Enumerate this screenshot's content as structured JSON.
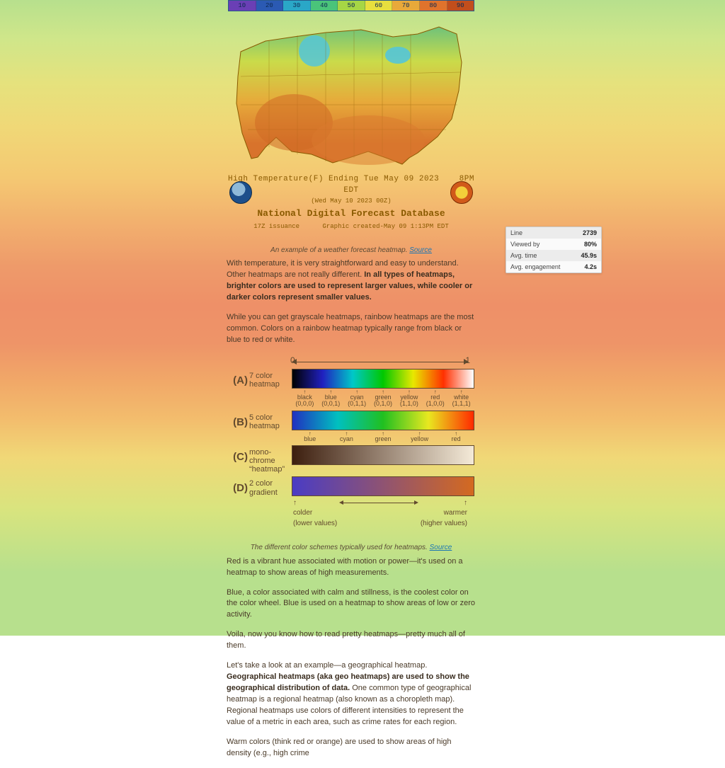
{
  "weather": {
    "scale_ticks": [
      "10",
      "20",
      "30",
      "40",
      "50",
      "60",
      "70",
      "80",
      "90"
    ],
    "line1_left": "High Temperature(F) Ending Tue May 09 2023",
    "line1_right": "8PM EDT",
    "line2": "(Wed May 10 2023 00Z)",
    "title": "National Digital Forecast Database",
    "line3_left": "17Z issuance",
    "line3_right": "Graphic created-May 09  1:13PM EDT"
  },
  "scale_colors": [
    "#6a3fb5",
    "#2b5ab3",
    "#2aa7c7",
    "#4ac47a",
    "#a6d645",
    "#e7df3e",
    "#e8a93a",
    "#e0732c",
    "#c24e1c"
  ],
  "caption1_text": "An example of a weather forecast heatmap. ",
  "caption1_link": "Source",
  "p1_a": "With temperature, it is very straightforward and easy to understand. Other heatmaps are not really different. ",
  "p1_bold": "In all types of heatmaps, brighter colors are used to represent larger values, while cooler or darker colors represent smaller values.",
  "p2": "While you can get grayscale heatmaps, rainbow heatmaps are the most common. Colors on a rainbow heatmap typically range from black or blue to red or white.",
  "schemes": {
    "zero": "0",
    "one": "1",
    "rows": [
      {
        "letter": "(A)",
        "t1": "7 color",
        "t2": "heatmap",
        "ticks": [
          "black\n(0,0,0)",
          "blue\n(0,0,1)",
          "cyan\n(0,1,1)",
          "green\n(0,1,0)",
          "yellow\n(1,1,0)",
          "red\n(1,0,0)",
          "white\n(1,1,1)"
        ]
      },
      {
        "letter": "(B)",
        "t1": "5 color",
        "t2": "heatmap",
        "ticks": [
          "blue",
          "cyan",
          "green",
          "yellow",
          "red"
        ]
      },
      {
        "letter": "(C)",
        "t1": "mono-",
        "t2": "chrome",
        "t3": "“heatmap”",
        "ticks": []
      },
      {
        "letter": "(D)",
        "t1": "2 color",
        "t2": "gradient",
        "ticks": []
      }
    ],
    "foot_left_1": "colder",
    "foot_left_2": "(lower values)",
    "foot_right_1": "warmer",
    "foot_right_2": "(higher values)"
  },
  "caption2_text": "The different color schemes typically used for heatmaps. ",
  "caption2_link": "Source",
  "p3": "Red is a vibrant hue associated with motion or power—it's used on a heatmap to show areas of high measurements.",
  "p4": "Blue, a color associated with calm and stillness, is the coolest color on the color wheel. Blue is used on a heatmap to show areas of low or zero activity.",
  "p5": "Voila, now you know how to read pretty heatmaps—pretty much all of them.",
  "p6_a": "Let's take a look at an example—a geographical heatmap. ",
  "p6_bold": "Geographical heatmaps (aka geo heatmaps) are used to show the geographical distribution of data.",
  "p6_b": " One common type of geographical heatmap is a regional heatmap (also known as a choropleth map). Regional heatmaps use colors of different intensities to represent the value of a metric in each area, such as crime rates for each region.",
  "p7": "Warm colors (think red or orange) are used to show areas of high density (e.g., high crime",
  "tooltip": {
    "rows": [
      {
        "k": "Line",
        "v": "2739"
      },
      {
        "k": "Viewed by",
        "v": "80%"
      },
      {
        "k": "Avg. time",
        "v": "45.9s"
      },
      {
        "k": "Avg. engagement",
        "v": "4.2s"
      }
    ]
  },
  "chart_data": [
    {
      "type": "heatmap",
      "title": "High Temperature (F) — National Digital Forecast Database",
      "description": "Choropleth-style forecast map of the contiguous United States colored by forecast high temperature in °F, valid Tue May 09 2023 8PM EDT.",
      "color_scale": {
        "min": 10,
        "max": 90,
        "step": 10,
        "ticks": [
          10,
          20,
          30,
          40,
          50,
          60,
          70,
          80,
          90
        ],
        "colors": [
          "#6a3fb5",
          "#2b5ab3",
          "#2aa7c7",
          "#4ac47a",
          "#a6d645",
          "#e7df3e",
          "#e8a93a",
          "#e0732c",
          "#c24e1c"
        ]
      },
      "regions_estimate_F": {
        "Pacific Northwest coast": 60,
        "Northern Rockies / N Plains": 55,
        "Great Lakes": 60,
        "Northeast": 62,
        "Midwest": 70,
        "Southeast": 80,
        "Texas / Gulf Coast": 88,
        "Desert Southwest (AZ/NM/S.CA)": 90,
        "Central CA valley": 80,
        "High Rockies": 40
      }
    },
    {
      "type": "table",
      "title": "Common heatmap color schemes, ordered 0 → 1",
      "rows": [
        {
          "id": "A",
          "name": "7 color heatmap",
          "stops": [
            "black",
            "blue",
            "cyan",
            "green",
            "yellow",
            "red",
            "white"
          ]
        },
        {
          "id": "B",
          "name": "5 color heatmap",
          "stops": [
            "blue",
            "cyan",
            "green",
            "yellow",
            "red"
          ]
        },
        {
          "id": "C",
          "name": "monochrome \"heatmap\"",
          "stops": [
            "dark brown",
            "cream"
          ]
        },
        {
          "id": "D",
          "name": "2 color gradient",
          "stops": [
            "purple (colder / lower values)",
            "orange (warmer / higher values)"
          ]
        }
      ],
      "axis": {
        "min": 0,
        "max": 1
      }
    }
  ]
}
